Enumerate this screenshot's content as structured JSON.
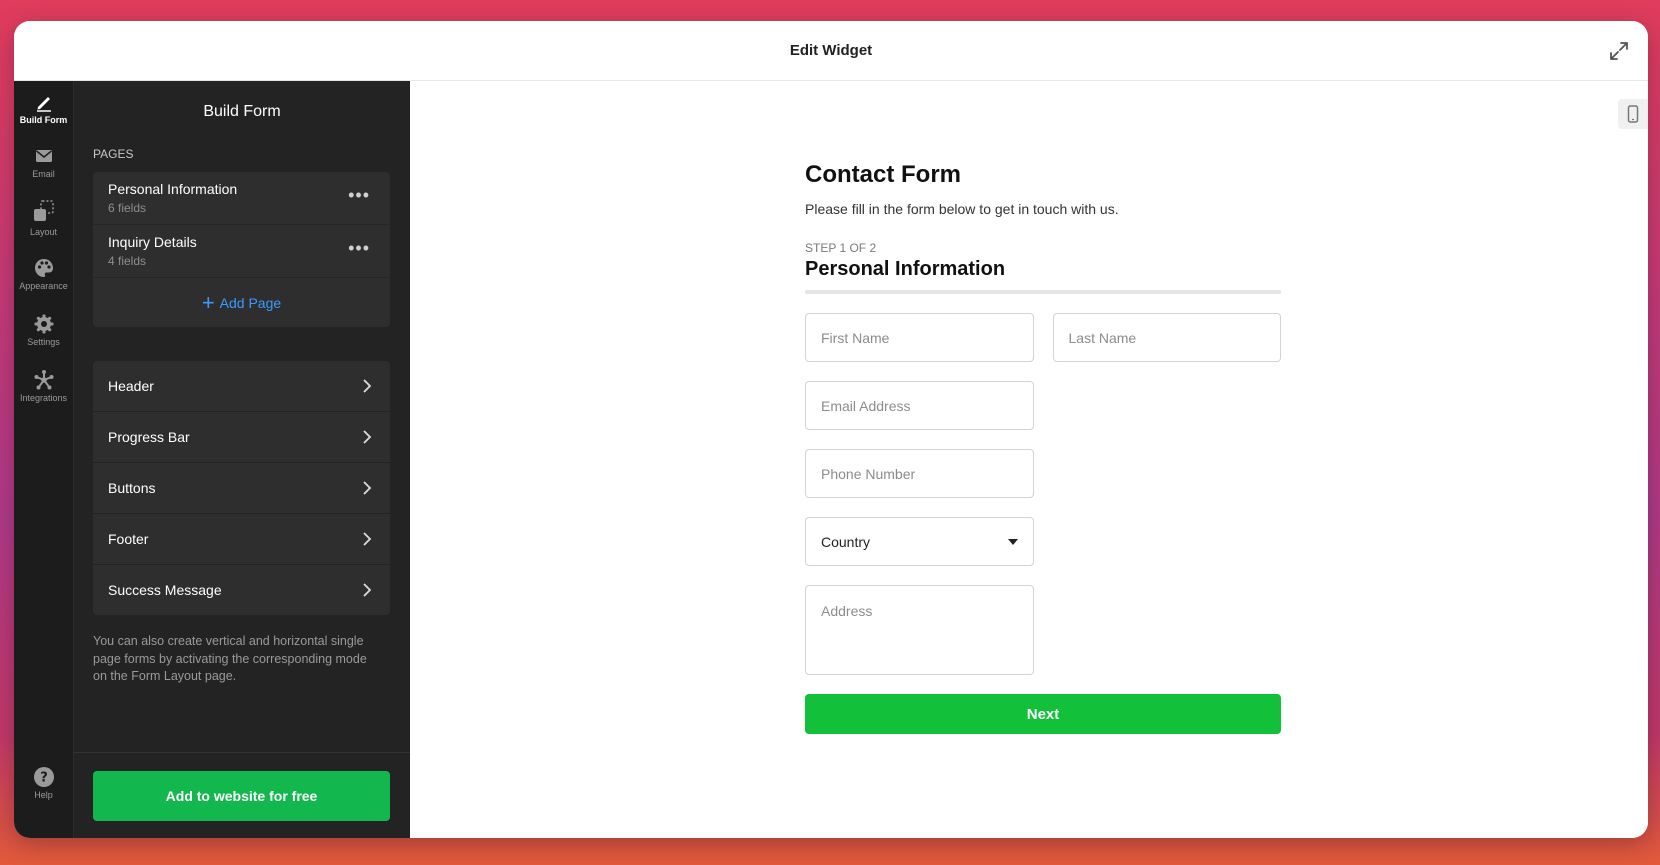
{
  "window": {
    "title": "Edit Widget"
  },
  "iconbar": {
    "items": [
      {
        "label": "Build Form",
        "icon": "pencil-icon"
      },
      {
        "label": "Email",
        "icon": "envelope-icon"
      },
      {
        "label": "Layout",
        "icon": "layout-icon"
      },
      {
        "label": "Appearance",
        "icon": "palette-icon"
      },
      {
        "label": "Settings",
        "icon": "gear-icon"
      },
      {
        "label": "Integrations",
        "icon": "integrations-icon"
      }
    ],
    "help": {
      "label": "Help",
      "icon": "help-icon"
    }
  },
  "panel": {
    "title": "Build Form",
    "pages_label": "PAGES",
    "pages": [
      {
        "name": "Personal Information",
        "meta": "6 fields"
      },
      {
        "name": "Inquiry Details",
        "meta": "4 fields"
      }
    ],
    "add_page_label": "Add Page",
    "sections": [
      "Header",
      "Progress Bar",
      "Buttons",
      "Footer",
      "Success Message"
    ],
    "note": "You can also create vertical and horizontal single page forms by activating the corresponding mode on the Form Layout page.",
    "cta_label": "Add to website for free"
  },
  "form": {
    "title": "Contact Form",
    "description": "Please fill in the form below to get in touch with us.",
    "step": "STEP 1 OF 2",
    "step_title": "Personal Information",
    "first_name_placeholder": "First Name",
    "last_name_placeholder": "Last Name",
    "email_placeholder": "Email Address",
    "phone_placeholder": "Phone Number",
    "country_value": "Country",
    "address_placeholder": "Address",
    "next_label": "Next"
  },
  "colors": {
    "accent_green": "#12b84e",
    "next_green": "#12c03a",
    "link_blue": "#3a9bff",
    "sidebar_dark": "#232323"
  }
}
